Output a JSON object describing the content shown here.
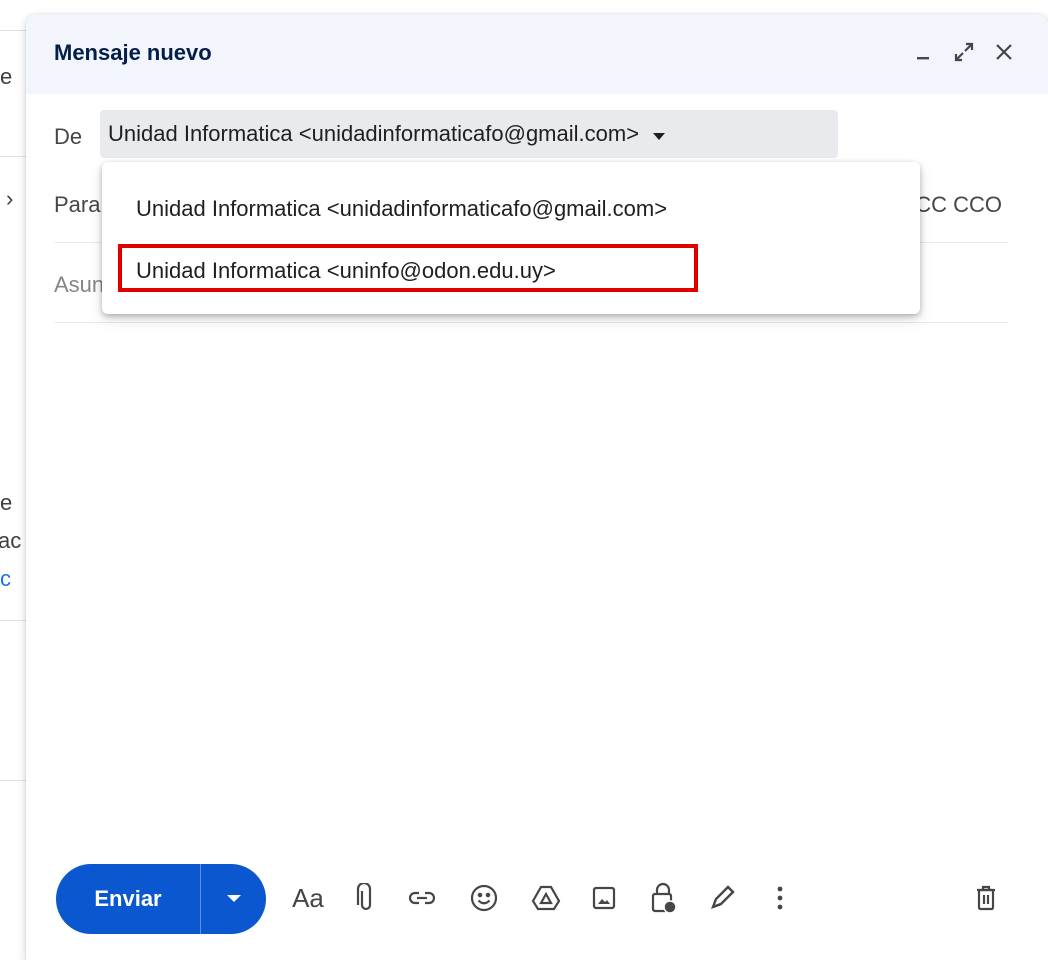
{
  "background": {
    "fragments": [
      "e",
      "›",
      "e",
      "ac",
      "c"
    ]
  },
  "compose": {
    "title": "Mensaje nuevo",
    "header_icons": [
      "minimize-icon",
      "expand-icon",
      "close-icon"
    ],
    "from_label": "De",
    "from_value": "Unidad Informatica <unidadinformaticafo@gmail.com>",
    "to_label": "Para",
    "cc_bcc_label": "CC CCO",
    "subject_label": "Asunto"
  },
  "dropdown": {
    "options": [
      "Unidad Informatica <unidadinformaticafo@gmail.com>",
      "Unidad Informatica <uninfo@odon.edu.uy>"
    ],
    "highlighted_index": 1,
    "highlight_color": "#e00000"
  },
  "toolbar": {
    "send_label": "Enviar",
    "format_label": "Aa",
    "icons": [
      "text-format-icon",
      "attach-icon",
      "link-icon",
      "emoji-icon",
      "drive-icon",
      "photo-icon",
      "confidential-icon",
      "signature-icon",
      "more-options-icon",
      "discard-icon"
    ]
  },
  "colors": {
    "accent": "#0b57d0",
    "header_bg": "#f2f6fc",
    "title": "#041e49"
  }
}
